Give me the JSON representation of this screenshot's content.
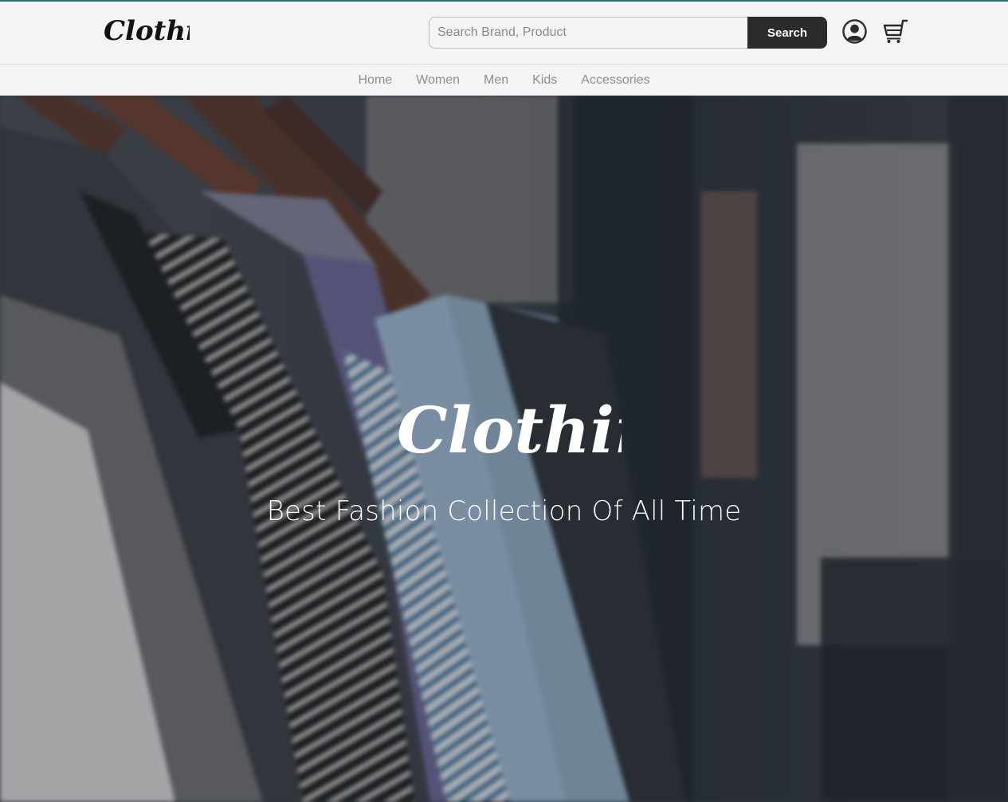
{
  "header": {
    "logo_text": "Clothing",
    "search": {
      "placeholder": "Search Brand, Product",
      "value": "",
      "button_label": "Search"
    },
    "icons": [
      "account-icon",
      "cart-icon"
    ]
  },
  "nav": {
    "items": [
      {
        "label": "Home"
      },
      {
        "label": "Women"
      },
      {
        "label": "Men"
      },
      {
        "label": "Kids"
      },
      {
        "label": "Accessories"
      }
    ]
  },
  "hero": {
    "logo_text": "Clothing",
    "tagline": "Best Fashion Collection Of All Time"
  },
  "colors": {
    "accent_line": "#2f6e73",
    "header_bg": "#f4f4f4",
    "button_bg": "#2b2b2b",
    "nav_text": "#8e8e8e"
  }
}
